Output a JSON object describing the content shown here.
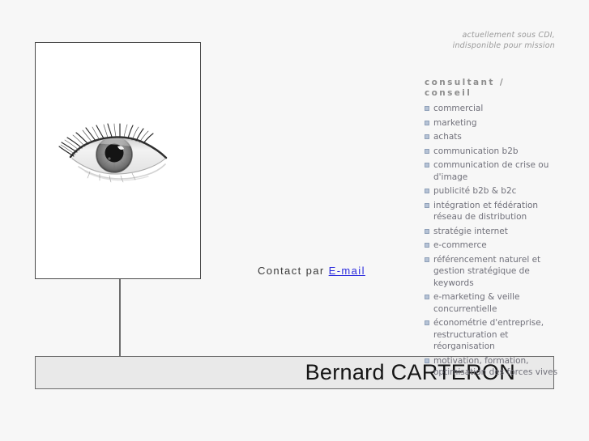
{
  "colors": {
    "background": "#f7f7f7",
    "frame_border": "#4a4a4a",
    "banner_fill": "#e9e9e9",
    "banner_border": "#6a6a6a",
    "link": "#2b2bdd",
    "skill_text": "#70707a",
    "heading_text": "#8d8d8d",
    "bullet": "#b6c3d6",
    "note_text": "#9a9a9a"
  },
  "status_note": {
    "line1": "actuellement sous CDI,",
    "line2": "indisponible pour mission"
  },
  "photo": {
    "alt": "eye-photograph"
  },
  "contact": {
    "prefix": "Contact par ",
    "link_label": "E-mail"
  },
  "banner": {
    "name": "Bernard CARTERON"
  },
  "skills": {
    "heading_line1": "consultant /",
    "heading_line2": "conseil",
    "items": [
      {
        "label": "commercial"
      },
      {
        "label": "marketing"
      },
      {
        "label": "achats"
      },
      {
        "label": "communication b2b"
      },
      {
        "label": "communication de crise ou d'image"
      },
      {
        "label": "publicité b2b & b2c"
      },
      {
        "label": "intégration et fédération réseau de distribution"
      },
      {
        "label": "stratégie internet"
      },
      {
        "label": "e-commerce"
      },
      {
        "label": "référencement naturel et gestion stratégique de keywords"
      },
      {
        "label": "e-marketing & veille concurrentielle"
      },
      {
        "label": "économétrie d'entreprise, restructuration et réorganisation"
      },
      {
        "label": "motivation, formation, optimisation des forces vives"
      }
    ]
  }
}
